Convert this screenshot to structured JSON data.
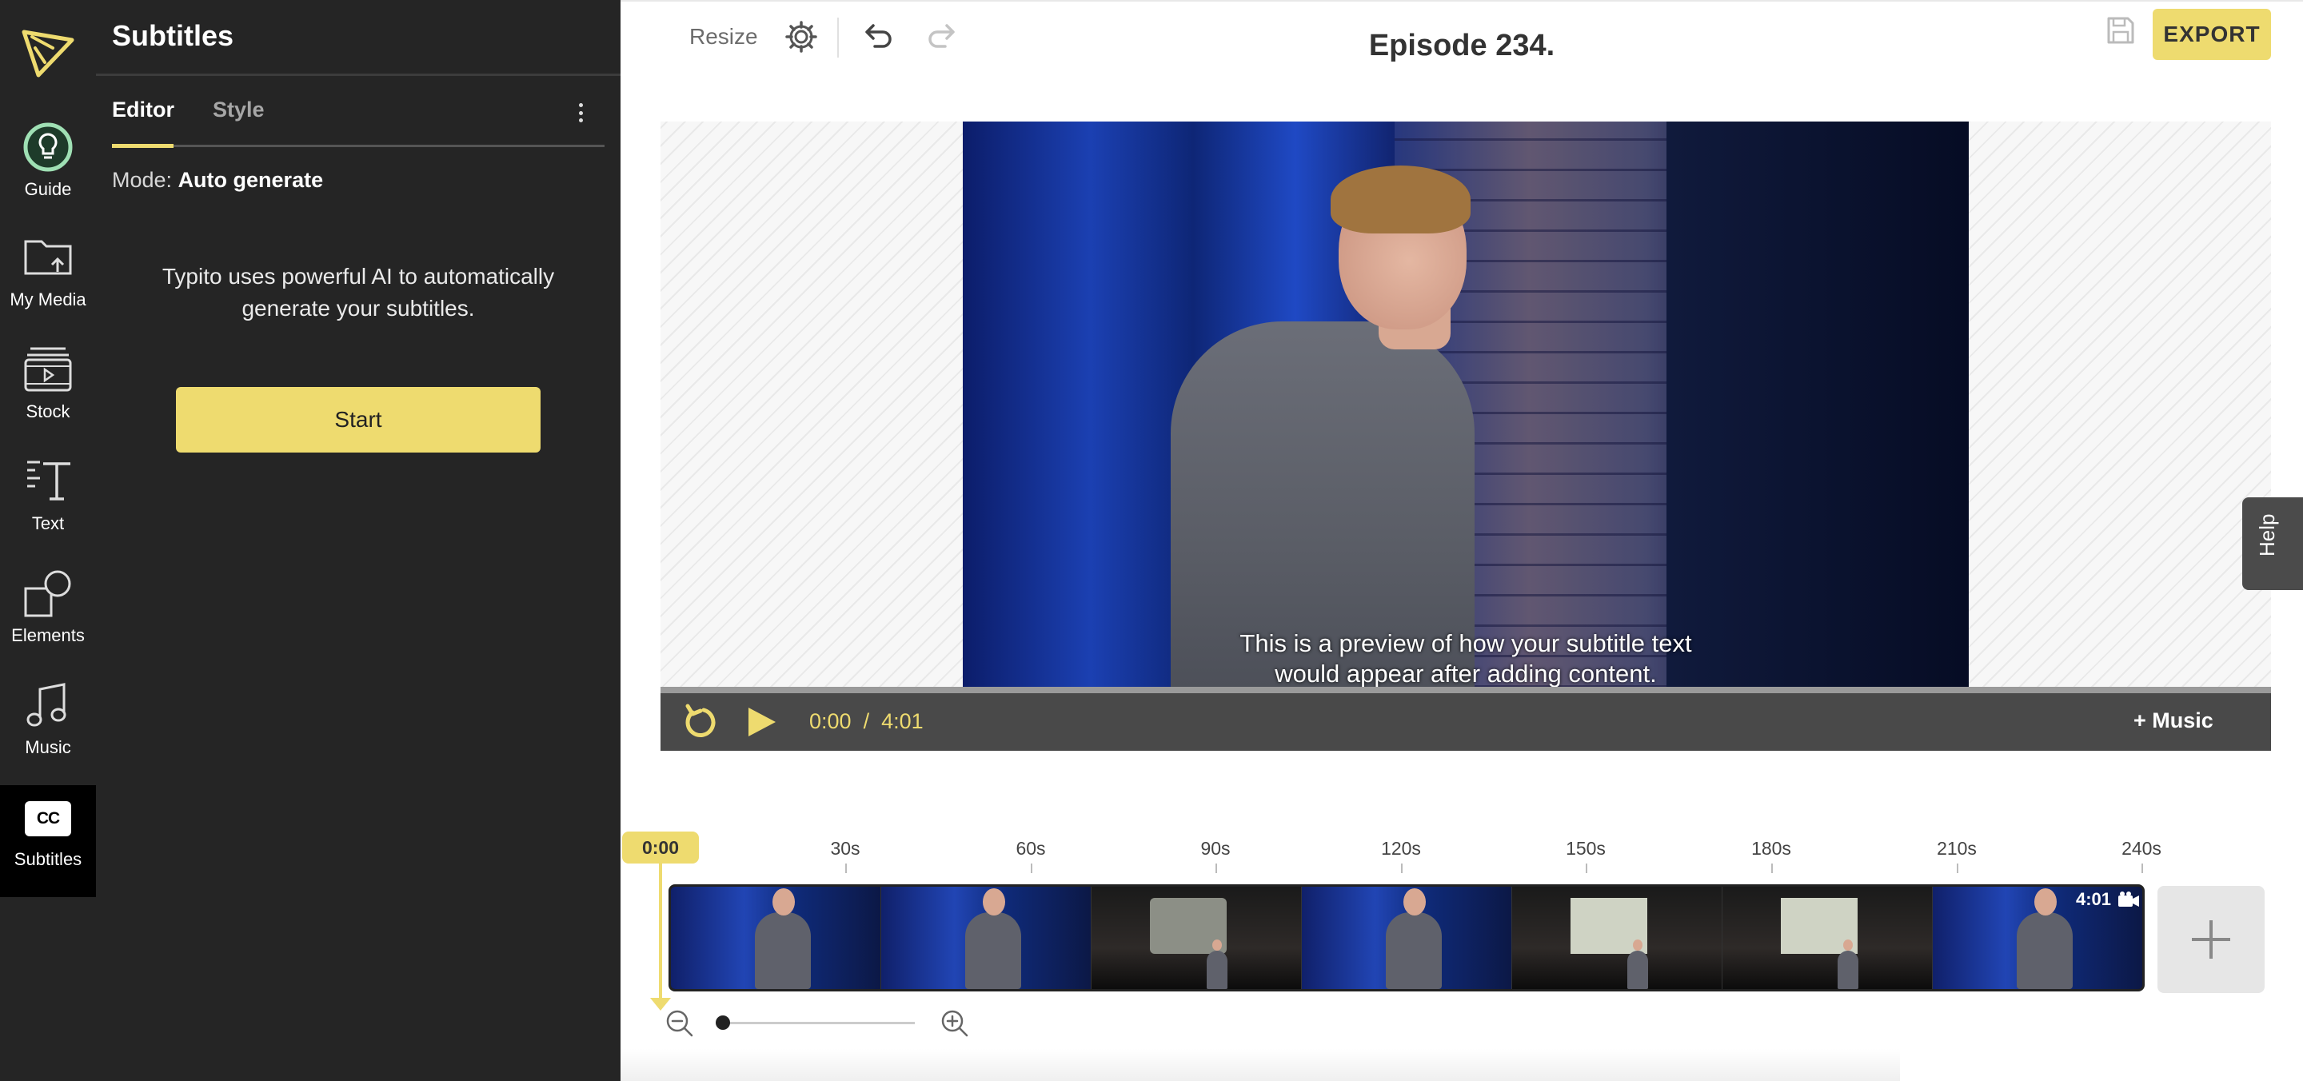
{
  "sidebar": {
    "items": [
      {
        "label": "Guide",
        "icon": "bulb-icon"
      },
      {
        "label": "My Media",
        "icon": "folder-upload-icon"
      },
      {
        "label": "Stock",
        "icon": "film-stack-icon"
      },
      {
        "label": "Text",
        "icon": "text-icon"
      },
      {
        "label": "Elements",
        "icon": "shapes-icon"
      },
      {
        "label": "Music",
        "icon": "music-note-icon"
      },
      {
        "label": "Subtitles",
        "icon": "closed-caption-icon",
        "badge": "CC",
        "active": true
      }
    ]
  },
  "panel": {
    "title": "Subtitles",
    "tabs": [
      {
        "label": "Editor",
        "active": true
      },
      {
        "label": "Style",
        "active": false
      }
    ],
    "mode_label": "Mode:",
    "mode_value": "Auto generate",
    "description": "Typito uses powerful AI to automatically generate your subtitles.",
    "start_label": "Start"
  },
  "toolbar": {
    "resize_label": "Resize",
    "project_title": "Episode 234.",
    "export_label": "EXPORT"
  },
  "player": {
    "subtitle_line1": "This is a preview of how your subtitle text",
    "subtitle_line2": "would appear after adding content.",
    "current_time": "0:00",
    "separator": "/",
    "duration": "4:01",
    "music_label": "+ Music"
  },
  "help_label": "Help",
  "timeline": {
    "playhead": "0:00",
    "ticks": [
      "30s",
      "60s",
      "90s",
      "120s",
      "150s",
      "180s",
      "210s",
      "240s"
    ],
    "clip_duration": "4:01",
    "zoom_level": 0
  },
  "colors": {
    "accent": "#eedb6f",
    "panel_bg": "#252525",
    "guide_ring": "#9fe0b4"
  }
}
